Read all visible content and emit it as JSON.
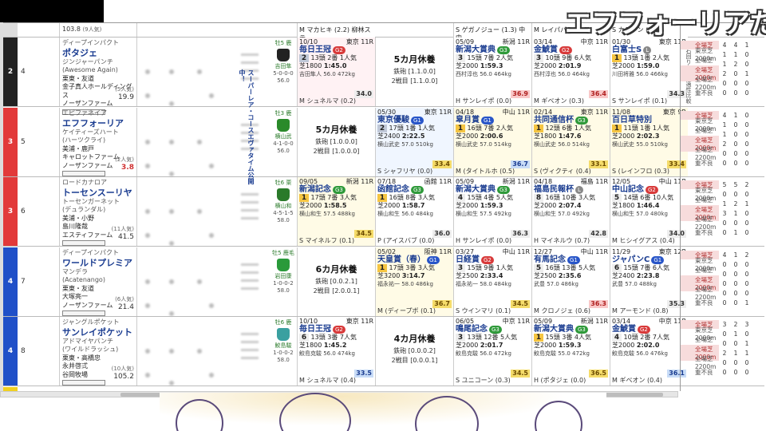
{
  "overlay": {
    "title": "エフフォーリアた"
  },
  "side_strip_label": "右回り左回り適性比較",
  "colors": {
    "frame2": "#222222",
    "frame3": "#e23a3a",
    "frame4": "#2050c8",
    "frame5": "#f0d020",
    "grade1": "#2855c8",
    "grade2": "#d83a3a",
    "grade3": "#2f9a3a"
  },
  "top_partial": {
    "odds": "103.8",
    "pop": "(9人気)",
    "races": [
      {
        "text": "M マカヒキ (2.2) 柳林ステ"
      },
      {
        "text": "S ゲガノジュー (1.3) 中中"
      },
      {
        "text": "M レイパパレ (0.3)"
      },
      {
        "text": "S カラテン (0.6)"
      }
    ]
  },
  "vertical_note": "スーパーレア・コースエヴァタイム公開中！",
  "rows": [
    {
      "frame": "2",
      "num": "4",
      "frame_color": "#222222",
      "sire": "ディープインパクト",
      "name": "ポタジェ",
      "dam": "ジンジャーパンチ",
      "dam_en": "(Awesome Again)",
      "trainer": "栗東・友道",
      "owner": "金子真人ホールディングス",
      "breeder": "ノーザンファーム",
      "odds": "19.9",
      "pop": "(5人気)",
      "odds_hot": false,
      "jockey": [
        "牡5 鹿",
        "吉田隼",
        "5-0-0-0",
        "56.0"
      ],
      "silk": "#222222",
      "races": [
        {
          "kind": "race",
          "hl": "hl-pink",
          "date": "10/10",
          "place": "東京 11R",
          "name": "毎日王冠",
          "grade": "G2",
          "gclass": "g2",
          "fin": "2",
          "fin_class": "second",
          "heads": "13頭 2番 1人気",
          "dist": "芝1800",
          "time": "1:45.0",
          "jockey": "吉田隼人 56.0 472kg",
          "rating": "34.0",
          "rclass": "plain",
          "foot": "M シュネルマ (0.2)"
        },
        {
          "kind": "rest",
          "big": "5カ月休養",
          "l1": "鉄砲 [1.1.0.0]",
          "l2": "2戦目 [1.1.0.0]"
        },
        {
          "kind": "race",
          "hl": "",
          "date": "05/09",
          "place": "新潟 11R",
          "name": "新潟大賞典",
          "grade": "G3",
          "gclass": "g3",
          "fin": "3",
          "fin_class": "",
          "heads": "15頭 7番 2人気",
          "dist": "芝2000",
          "time": "1:59.3",
          "jockey": "西村淳也 56.0 464kg",
          "rating": "36.9",
          "rclass": "red",
          "foot": "H サンレイポ (0.0)"
        },
        {
          "kind": "race",
          "hl": "",
          "date": "03/14",
          "place": "中京 11R",
          "name": "金鯱賞",
          "grade": "G2",
          "gclass": "g2",
          "fin": "3",
          "fin_class": "",
          "heads": "10頭 9番 6人気",
          "dist": "芝2000",
          "time": "2:01.9",
          "jockey": "西村淳也 56.0 464kg",
          "rating": "36.4",
          "rclass": "red",
          "foot": "M ギベオン (0.3)"
        },
        {
          "kind": "race",
          "hl": "",
          "date": "01/30",
          "place": "東京 11R",
          "name": "白富士S",
          "grade": "L",
          "gclass": "gl",
          "fin": "1",
          "fin_class": "first",
          "heads": "13頭 1番 2人気",
          "dist": "芝2000",
          "time": "1:59.0",
          "jockey": "川田将雅 56.0 466kg",
          "rating": "34.3",
          "rclass": "plain",
          "foot": "S サンレイポ (0.1)"
        }
      ]
    },
    {
      "frame": "3",
      "num": "5",
      "frame_color": "#e23a3a",
      "sire": "エピファネイア",
      "name": "エフフォーリア",
      "dam": "ケイティーズハート",
      "dam_en": "(ハーツクライ)",
      "trainer": "美浦・鹿戸",
      "owner": "キャロットファーム",
      "breeder": "ノーザンファーム",
      "odds": "3.8",
      "pop": "(2人気)",
      "odds_hot": true,
      "jockey": [
        "牡3 鹿",
        "横山武",
        "4-1-0-0",
        "56.0"
      ],
      "silk": "#2a8a2a",
      "races": [
        {
          "kind": "rest",
          "big": "5カ月休養",
          "l1": "鉄砲 [1.0.0.0]",
          "l2": "2戦目 [1.0.0.0]"
        },
        {
          "kind": "race",
          "hl": "hl-blue",
          "date": "05/30",
          "place": "東京 11R",
          "name": "東京優駿",
          "grade": "G1",
          "gclass": "g1",
          "fin": "2",
          "fin_class": "second",
          "heads": "17頭 1番 1人気",
          "dist": "芝2400",
          "time": "2:22.5",
          "jockey": "横山武史 57.0 510kg",
          "rating": "33.4",
          "rclass": "gold",
          "foot": "S シャフリヤ (0.0)"
        },
        {
          "kind": "race",
          "hl": "hl-yellow",
          "date": "04/18",
          "place": "中山 11R",
          "name": "皐月賞",
          "grade": "G1",
          "gclass": "g1",
          "fin": "1",
          "fin_class": "first",
          "heads": "16頭 7番 2人気",
          "dist": "芝2000",
          "time": "2:00.6",
          "jockey": "横山武史 57.0 514kg",
          "rating": "36.7",
          "rclass": "blue",
          "foot": "M (タイトルホ (0.5)"
        },
        {
          "kind": "race",
          "hl": "hl-yellow",
          "date": "02/14",
          "place": "東京 11R",
          "name": "共同通信杯",
          "grade": "G3",
          "gclass": "g3",
          "fin": "1",
          "fin_class": "first",
          "heads": "12頭 6番 1人気",
          "dist": "芝1800",
          "time": "1:47.6",
          "jockey": "横山武史 56.0 514kg",
          "rating": "33.1",
          "rclass": "gold",
          "foot": "S (ヴィクティ (0.4)"
        },
        {
          "kind": "race",
          "hl": "hl-yellow",
          "date": "11/08",
          "place": "東京 9R",
          "name": "百日草特別",
          "grade": "",
          "gclass": "",
          "fin": "1",
          "fin_class": "first",
          "heads": "11頭 1番 1人気",
          "dist": "芝2000",
          "time": "2:02.3",
          "jockey": "横山武史 55.0 510kg",
          "rating": "33.4",
          "rclass": "gold",
          "foot": "S (レインフロ (0.3)"
        }
      ]
    },
    {
      "frame": "3",
      "num": "6",
      "frame_color": "#e23a3a",
      "sire": "ロードカナロア",
      "name": "トーセンスーリヤ",
      "dam": "トーセンガーネット",
      "dam_en": "(デュランダル)",
      "trainer": "美浦・小野",
      "owner": "島川隆哉",
      "breeder": "エスティファーム",
      "odds": "41.5",
      "pop": "(11人気)",
      "odds_hot": false,
      "jockey": [
        "牡6 栗",
        "横山和",
        "4-5-1-5",
        "58.0"
      ],
      "silk": "#2a7a2a",
      "races": [
        {
          "kind": "race",
          "hl": "hl-yellow",
          "date": "09/05",
          "place": "新潟 11R",
          "name": "新潟記念",
          "grade": "G3",
          "gclass": "g3",
          "fin": "1",
          "fin_class": "first",
          "heads": "17頭 7番 3人気",
          "dist": "芝2000",
          "time": "1:58.5",
          "jockey": "横山和生 57.5 488kg",
          "rating": "34.5",
          "rclass": "gold",
          "foot": "S マイネルフ (0.1)"
        },
        {
          "kind": "race",
          "hl": "",
          "date": "07/18",
          "place": "函館 11R",
          "name": "函館記念",
          "grade": "G3",
          "gclass": "g3",
          "fin": "1",
          "fin_class": "first",
          "heads": "16頭 8番 3人気",
          "dist": "芝2000",
          "time": "1:58.7",
          "jockey": "横山和生 56.0 484kg",
          "rating": "36.0",
          "rclass": "plain",
          "foot": "P (アイスバブ (0.0)"
        },
        {
          "kind": "race",
          "hl": "",
          "date": "05/09",
          "place": "新潟 11R",
          "name": "新潟大賞典",
          "grade": "G3",
          "gclass": "g3",
          "fin": "4",
          "fin_class": "",
          "heads": "15頭 4番 5人気",
          "dist": "芝2000",
          "time": "1:59.3",
          "jockey": "横山和生 57.5 492kg",
          "rating": "36.3",
          "rclass": "plain",
          "foot": "H サンレイポ (0.0)"
        },
        {
          "kind": "race",
          "hl": "",
          "date": "04/18",
          "place": "福島 11R",
          "name": "福島民報杯",
          "grade": "L",
          "gclass": "gl",
          "fin": "8",
          "fin_class": "",
          "heads": "16頭 10番 3人気",
          "dist": "芝2000",
          "time": "2:07.4",
          "jockey": "横山和生 57.0 492kg",
          "rating": "42.8",
          "rclass": "plain",
          "foot": "H マイネルウ (0.7)"
        },
        {
          "kind": "race",
          "hl": "",
          "date": "12/05",
          "place": "中山 11R",
          "name": "中山記念",
          "grade": "G2",
          "gclass": "g2",
          "fin": "5",
          "fin_class": "",
          "heads": "14頭 6番 10人気",
          "dist": "芝1800",
          "time": "1:46.4",
          "jockey": "横山和生 57.0 480kg",
          "rating": "34.0",
          "rclass": "plain",
          "foot": "M ヒシイグアス (0.4)"
        }
      ]
    },
    {
      "frame": "4",
      "num": "7",
      "frame_color": "#2050c8",
      "sire": "ディープインパクト",
      "name": "ワールドプレミア",
      "dam": "マンデラ",
      "dam_en": "(Acatenango)",
      "trainer": "栗東・友道",
      "owner": "大塚亮一",
      "breeder": "ノーザンファーム",
      "odds": "21.4",
      "pop": "(6人気)",
      "odds_hot": false,
      "jockey": [
        "牡5 鹿毛",
        "岩田康",
        "1-0-0-2",
        "58.0"
      ],
      "silk": "#2a9a3a",
      "races": [
        {
          "kind": "rest",
          "big": "6カ月休養",
          "l1": "鉄砲 [0.0.2.1]",
          "l2": "2戦目 [2.0.0.1]"
        },
        {
          "kind": "race",
          "hl": "hl-yellow",
          "date": "05/02",
          "place": "阪神 11R",
          "name": "天皇賞（春）",
          "grade": "G1",
          "gclass": "g1",
          "fin": "1",
          "fin_class": "first",
          "heads": "17頭 3番 3人気",
          "dist": "芝3200",
          "time": "3:14.7",
          "jockey": "福永祐一 58.0 486kg",
          "rating": "36.7",
          "rclass": "gold",
          "foot": "M (ディープボ (0.1)"
        },
        {
          "kind": "race",
          "hl": "",
          "date": "03/27",
          "place": "中山 11R",
          "name": "日経賞",
          "grade": "G2",
          "gclass": "g2",
          "fin": "3",
          "fin_class": "",
          "heads": "15頭 9番 1人気",
          "dist": "芝2500",
          "time": "2:33.4",
          "jockey": "福永祐一 58.0 484kg",
          "rating": "34.5",
          "rclass": "gold",
          "foot": "S ウインマリ (0.1)"
        },
        {
          "kind": "race",
          "hl": "",
          "date": "12/27",
          "place": "中山 11R",
          "name": "有馬記念",
          "grade": "G1",
          "gclass": "g1",
          "fin": "5",
          "fin_class": "",
          "heads": "16頭 13番 5人気",
          "dist": "芝2500",
          "time": "2:35.6",
          "jockey": "武豊 57.0 486kg",
          "rating": "36.3",
          "rclass": "red",
          "foot": "M クロノジェ (0.6)"
        },
        {
          "kind": "race",
          "hl": "",
          "date": "11/29",
          "place": "東京 12R",
          "name": "ジャパンC",
          "grade": "G1",
          "gclass": "g1",
          "fin": "6",
          "fin_class": "",
          "heads": "15頭 7番 6人気",
          "dist": "芝2400",
          "time": "2:23.8",
          "jockey": "武豊 57.0 488kg",
          "rating": "35.3",
          "rclass": "plain",
          "foot": "M アーモンド (0.8)"
        }
      ]
    },
    {
      "frame": "4",
      "num": "8",
      "frame_color": "#2050c8",
      "sire": "ジャングルポケット",
      "name": "サンレイポケット",
      "dam": "アドマイヤパンチ",
      "dam_en": "(ワイルドラッシュ)",
      "trainer": "栗東・高橋忠",
      "owner": "永井啓弍",
      "breeder": "谷岡牧場",
      "odds": "105.2",
      "pop": "(10人気)",
      "odds_hot": false,
      "jockey": [
        "牡6 鹿",
        "鮫島駿",
        "1-0-0-2",
        "58.0"
      ],
      "silk": "#3aa0a0",
      "races": [
        {
          "kind": "race",
          "hl": "",
          "date": "10/10",
          "place": "東京 11R",
          "name": "毎日王冠",
          "grade": "G2",
          "gclass": "g2",
          "fin": "6",
          "fin_class": "",
          "heads": "13頭 3番 7人気",
          "dist": "芝1800",
          "time": "1:45.2",
          "jockey": "鮫島克駿 56.0 474kg",
          "rating": "33.5",
          "rclass": "blue",
          "foot": "M シュネルマ (0.4)"
        },
        {
          "kind": "rest",
          "big": "4カ月休養",
          "l1": "鉄砲 [0.0.0.2]",
          "l2": "2戦目 [0.0.0.1]"
        },
        {
          "kind": "race",
          "hl": "",
          "date": "06/05",
          "place": "中京 11R",
          "name": "鳴尾記念",
          "grade": "G3",
          "gclass": "g3",
          "fin": "3",
          "fin_class": "",
          "heads": "13頭 12番 5人気",
          "dist": "芝2000",
          "time": "2:01.7",
          "jockey": "鮫島克駿 56.0 472kg",
          "rating": "34.5",
          "rclass": "gold",
          "foot": "S ユニコーン (0.3)"
        },
        {
          "kind": "race",
          "hl": "",
          "date": "05/09",
          "place": "新潟 11R",
          "name": "新潟大賞典",
          "grade": "G3",
          "gclass": "g3",
          "fin": "1",
          "fin_class": "first",
          "heads": "15頭 3番 4人気",
          "dist": "芝2000",
          "time": "1:59.3",
          "jockey": "鮫島克駿 55.0 472kg",
          "rating": "36.5",
          "rclass": "gold",
          "foot": "H (ポタジェ (0.0)"
        },
        {
          "kind": "race",
          "hl": "",
          "date": "03/14",
          "place": "中京 11R",
          "name": "金鯱賞",
          "grade": "G2",
          "gclass": "g2",
          "fin": "4",
          "fin_class": "",
          "heads": "10頭 2番 7人気",
          "dist": "芝2000",
          "time": "2:02.0",
          "jockey": "鮫島克駿 56.0 476kg",
          "rating": "36.1",
          "rclass": "blue",
          "foot": "M ギベオン (0.4)"
        }
      ]
    }
  ],
  "side_panel": [
    {
      "rows": [
        {
          "lbl": "全場芝",
          "a": "4",
          "b": "4",
          "c": "1"
        },
        {
          "lbl": "東京芝2000m",
          "a": "1",
          "b": "1",
          "c": "0"
        },
        {
          "lbl": "全場芝1800m",
          "a": "1",
          "b": "2",
          "c": "0"
        },
        {
          "lbl": "全場芝2000m",
          "a": "2",
          "b": "0",
          "c": "1"
        },
        {
          "lbl": "全場芝2200m",
          "a": "0",
          "b": "0",
          "c": "0"
        },
        {
          "lbl": "重不良",
          "a": "0",
          "b": "0",
          "c": "0"
        }
      ]
    },
    {
      "rows": [
        {
          "lbl": "全場芝",
          "a": "4",
          "b": "1",
          "c": "0"
        },
        {
          "lbl": "東京芝2000m",
          "a": "1",
          "b": "0",
          "c": "0"
        },
        {
          "lbl": "全場芝1800m",
          "a": "1",
          "b": "0",
          "c": "0"
        },
        {
          "lbl": "全場芝2000m",
          "a": "2",
          "b": "0",
          "c": "0"
        },
        {
          "lbl": "全場芝2200m",
          "a": "0",
          "b": "0",
          "c": "0"
        },
        {
          "lbl": "重不良",
          "a": "0",
          "b": "0",
          "c": "0"
        }
      ]
    },
    {
      "rows": [
        {
          "lbl": "全場芝",
          "a": "5",
          "b": "5",
          "c": "2"
        },
        {
          "lbl": "東京芝2000m",
          "a": "0",
          "b": "0",
          "c": "0"
        },
        {
          "lbl": "全場芝1800m",
          "a": "1",
          "b": "2",
          "c": "1"
        },
        {
          "lbl": "全場芝2000m",
          "a": "3",
          "b": "1",
          "c": "0"
        },
        {
          "lbl": "全場芝2200m",
          "a": "0",
          "b": "0",
          "c": "0"
        },
        {
          "lbl": "重不良",
          "a": "0",
          "b": "1",
          "c": "0"
        }
      ]
    },
    {
      "rows": [
        {
          "lbl": "全場芝",
          "a": "4",
          "b": "1",
          "c": "2"
        },
        {
          "lbl": "東京芝2000m",
          "a": "0",
          "b": "0",
          "c": "0"
        },
        {
          "lbl": "全場芝1800m",
          "a": "0",
          "b": "0",
          "c": "0"
        },
        {
          "lbl": "全場芝2000m",
          "a": "0",
          "b": "0",
          "c": "0"
        },
        {
          "lbl": "全場芝2200m",
          "a": "0",
          "b": "0",
          "c": "0"
        },
        {
          "lbl": "重不良",
          "a": "0",
          "b": "0",
          "c": "1"
        }
      ]
    },
    {
      "rows": [
        {
          "lbl": "全場芝",
          "a": "3",
          "b": "2",
          "c": "3"
        },
        {
          "lbl": "東京芝2000m",
          "a": "0",
          "b": "1",
          "c": "0"
        },
        {
          "lbl": "全場芝1800m",
          "a": "0",
          "b": "0",
          "c": "1"
        },
        {
          "lbl": "全場芝2000m",
          "a": "2",
          "b": "1",
          "c": "1"
        },
        {
          "lbl": "全場芝2200m",
          "a": "0",
          "b": "0",
          "c": "0"
        },
        {
          "lbl": "重不良",
          "a": "0",
          "b": "0",
          "c": "0"
        }
      ]
    }
  ],
  "bottom_partial": {
    "date_a": "06/06",
    "place_a": "東京 11R",
    "date_b": "11/23",
    "place_b": "東京 11R"
  }
}
